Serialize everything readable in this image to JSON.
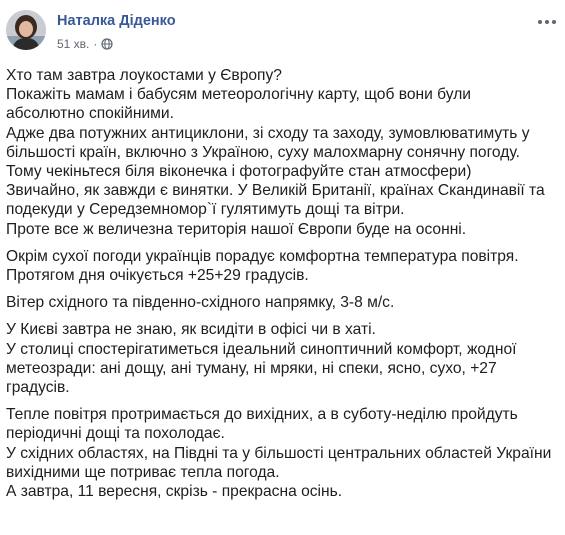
{
  "author": {
    "name": "Наталка Діденко",
    "time": "51 хв.",
    "privacy_icon": "globe-icon"
  },
  "menu_icon": "more-horizontal-icon",
  "paragraphs": [
    {
      "lines": [
        "Хто там завтра лоукостами у Європу?",
        "Покажіть мамам і бабусям метеорологічну карту, щоб вони були",
        "абсолютно спокійними.",
        "Адже два потужних антициклони, зі сходу та заходу, зумовлюватимуть у",
        "більшості країн, включно з Україною, суху малохмарну сонячну погоду.",
        "Тому чекіньтеся біля віконечка і фотографуйте стан атмосфери)",
        "Звичайно, як завжди є винятки. У Великій Британії, країнах Скандинавії та",
        "подекуди у Середземномор`ї гулятимуть дощі та вітри.",
        "Проте все ж величезна територія нашої Європи буде на осонні."
      ]
    },
    {
      "lines": [
        "Окрім сухої погоди українців порадує комфортна температура повітря.",
        "Протягом дня очікується +25+29 градусів."
      ]
    },
    {
      "lines": [
        "Вітер східного та південно-східного напрямку, 3-8 м/с."
      ]
    },
    {
      "lines": [
        "У Києві завтра не знаю, як всидіти в офісі чи в хаті.",
        "У столиці спостерігатиметься ідеальний синоптичний комфорт, жодної",
        "метеозради: ані дощу, ані туману, ні мряки, ні спеки, ясно, сухо, +27",
        "градусів."
      ]
    },
    {
      "lines": [
        "Тепле повітря протримається до вихідних, а в суботу-неділю пройдуть",
        "періодичні дощі та похолодає.",
        "У східних областях, на Півдні та у більшості центральних областей України",
        "вихідними ще потриває тепла погода.",
        "А завтра, 11 вересня, скрізь - прекрасна осінь."
      ]
    }
  ]
}
